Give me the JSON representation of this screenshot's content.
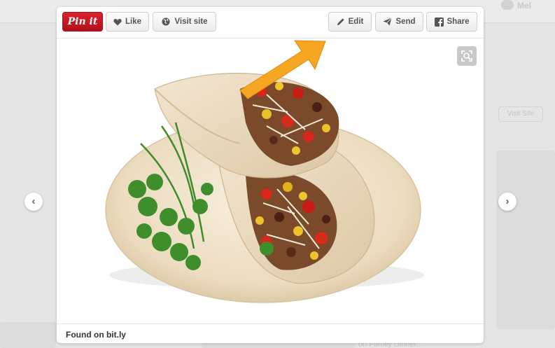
{
  "background": {
    "user_name": "Mel",
    "side_button_label": "Visit Site",
    "bottom_text": "on Family Dinner..."
  },
  "toolbar": {
    "pinit_label": "Pin it",
    "like_label": "Like",
    "visit_site_label": "Visit site",
    "edit_label": "Edit",
    "send_label": "Send",
    "share_label": "Share"
  },
  "pin": {
    "image_icon": "burrito-wraps-photo",
    "footer_text": "Found on bit.ly"
  },
  "colors": {
    "brand_red": "#cb2027",
    "arrow_orange": "#f5a623"
  }
}
